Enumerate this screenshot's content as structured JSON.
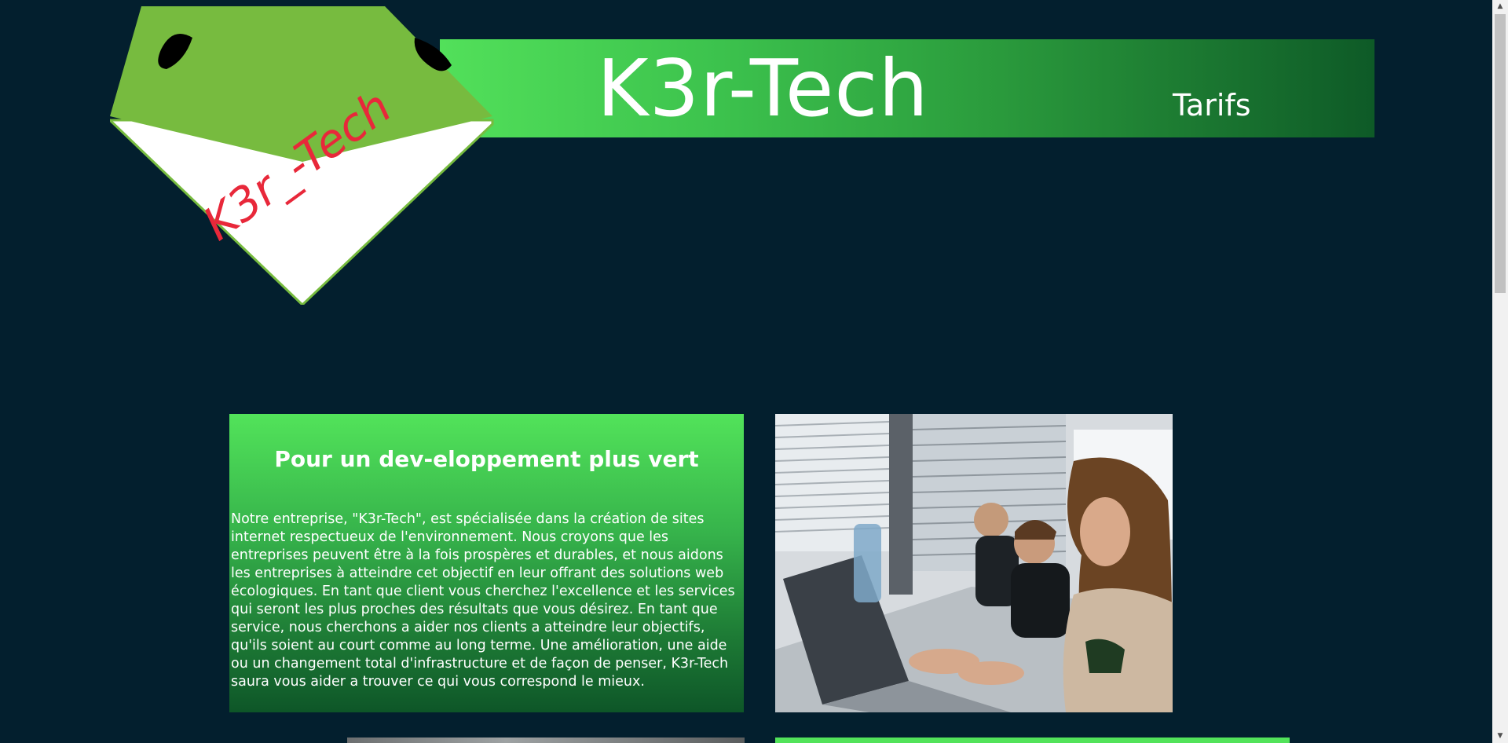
{
  "header": {
    "brand": "K3r-Tech",
    "nav": [
      {
        "label": "Tarifs"
      }
    ],
    "logo_text": "K3r_-Tech",
    "colors": {
      "banner_start": "#52e05a",
      "banner_end": "#0e5a27",
      "background": "#031f2e",
      "logo_green": "#77bb3f",
      "logo_text": "#e8283a"
    }
  },
  "intro": {
    "heading": "Pour un dev-eloppement plus vert",
    "body": "Notre entreprise, \"K3r-Tech\", est spécialisée dans la création de sites internet respectueux de l'environnement. Nous croyons que les entreprises peuvent être à la fois prospères et durables, et nous aidons les entreprises à atteindre cet objectif en leur offrant des solutions web écologiques. En tant que client vous cherchez l'excellence et les services qui seront les plus proches des résultats que vous désirez. En tant que service, nous cherchons a aider nos clients a atteindre leur objectifs, qu'ils soient au court comme au long terme. Une amélioration, une aide ou un changement total d'infrastructure et de façon de penser, K3r-Tech saura vous aider a trouver ce qui vous correspond le mieux."
  },
  "icons": {
    "scroll_up": "▲",
    "scroll_down": "▼"
  }
}
